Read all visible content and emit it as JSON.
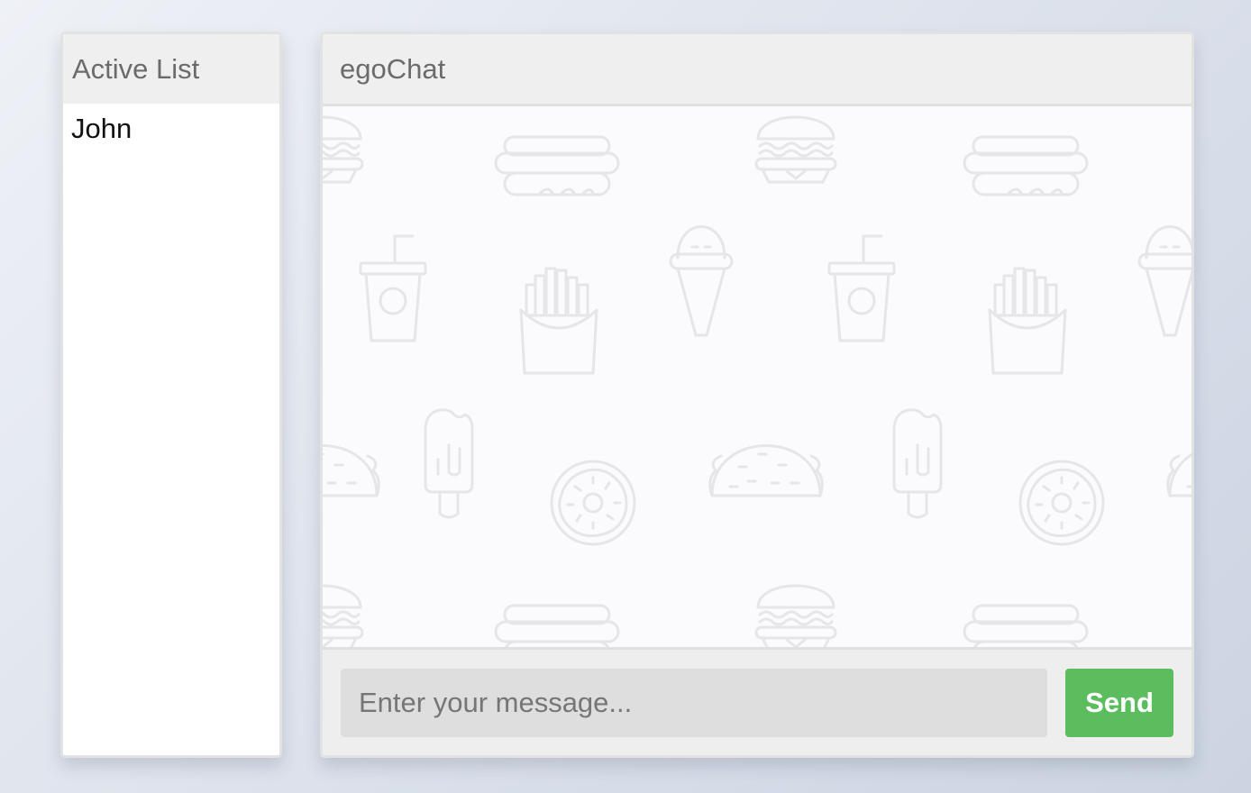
{
  "active_list": {
    "title": "Active List",
    "users": [
      "John"
    ]
  },
  "chat": {
    "title": "egoChat",
    "background_icons": [
      "burger-icon",
      "hotdog-icon",
      "soda-cup-icon",
      "fries-icon",
      "ice-cream-cone-icon",
      "popsicle-icon",
      "donut-icon",
      "taco-icon"
    ],
    "input": {
      "placeholder": "Enter your message...",
      "value": ""
    },
    "send_label": "Send"
  },
  "colors": {
    "send_button": "#5cbd5e",
    "panel_header": "#efefef",
    "input_background": "#dedede"
  }
}
